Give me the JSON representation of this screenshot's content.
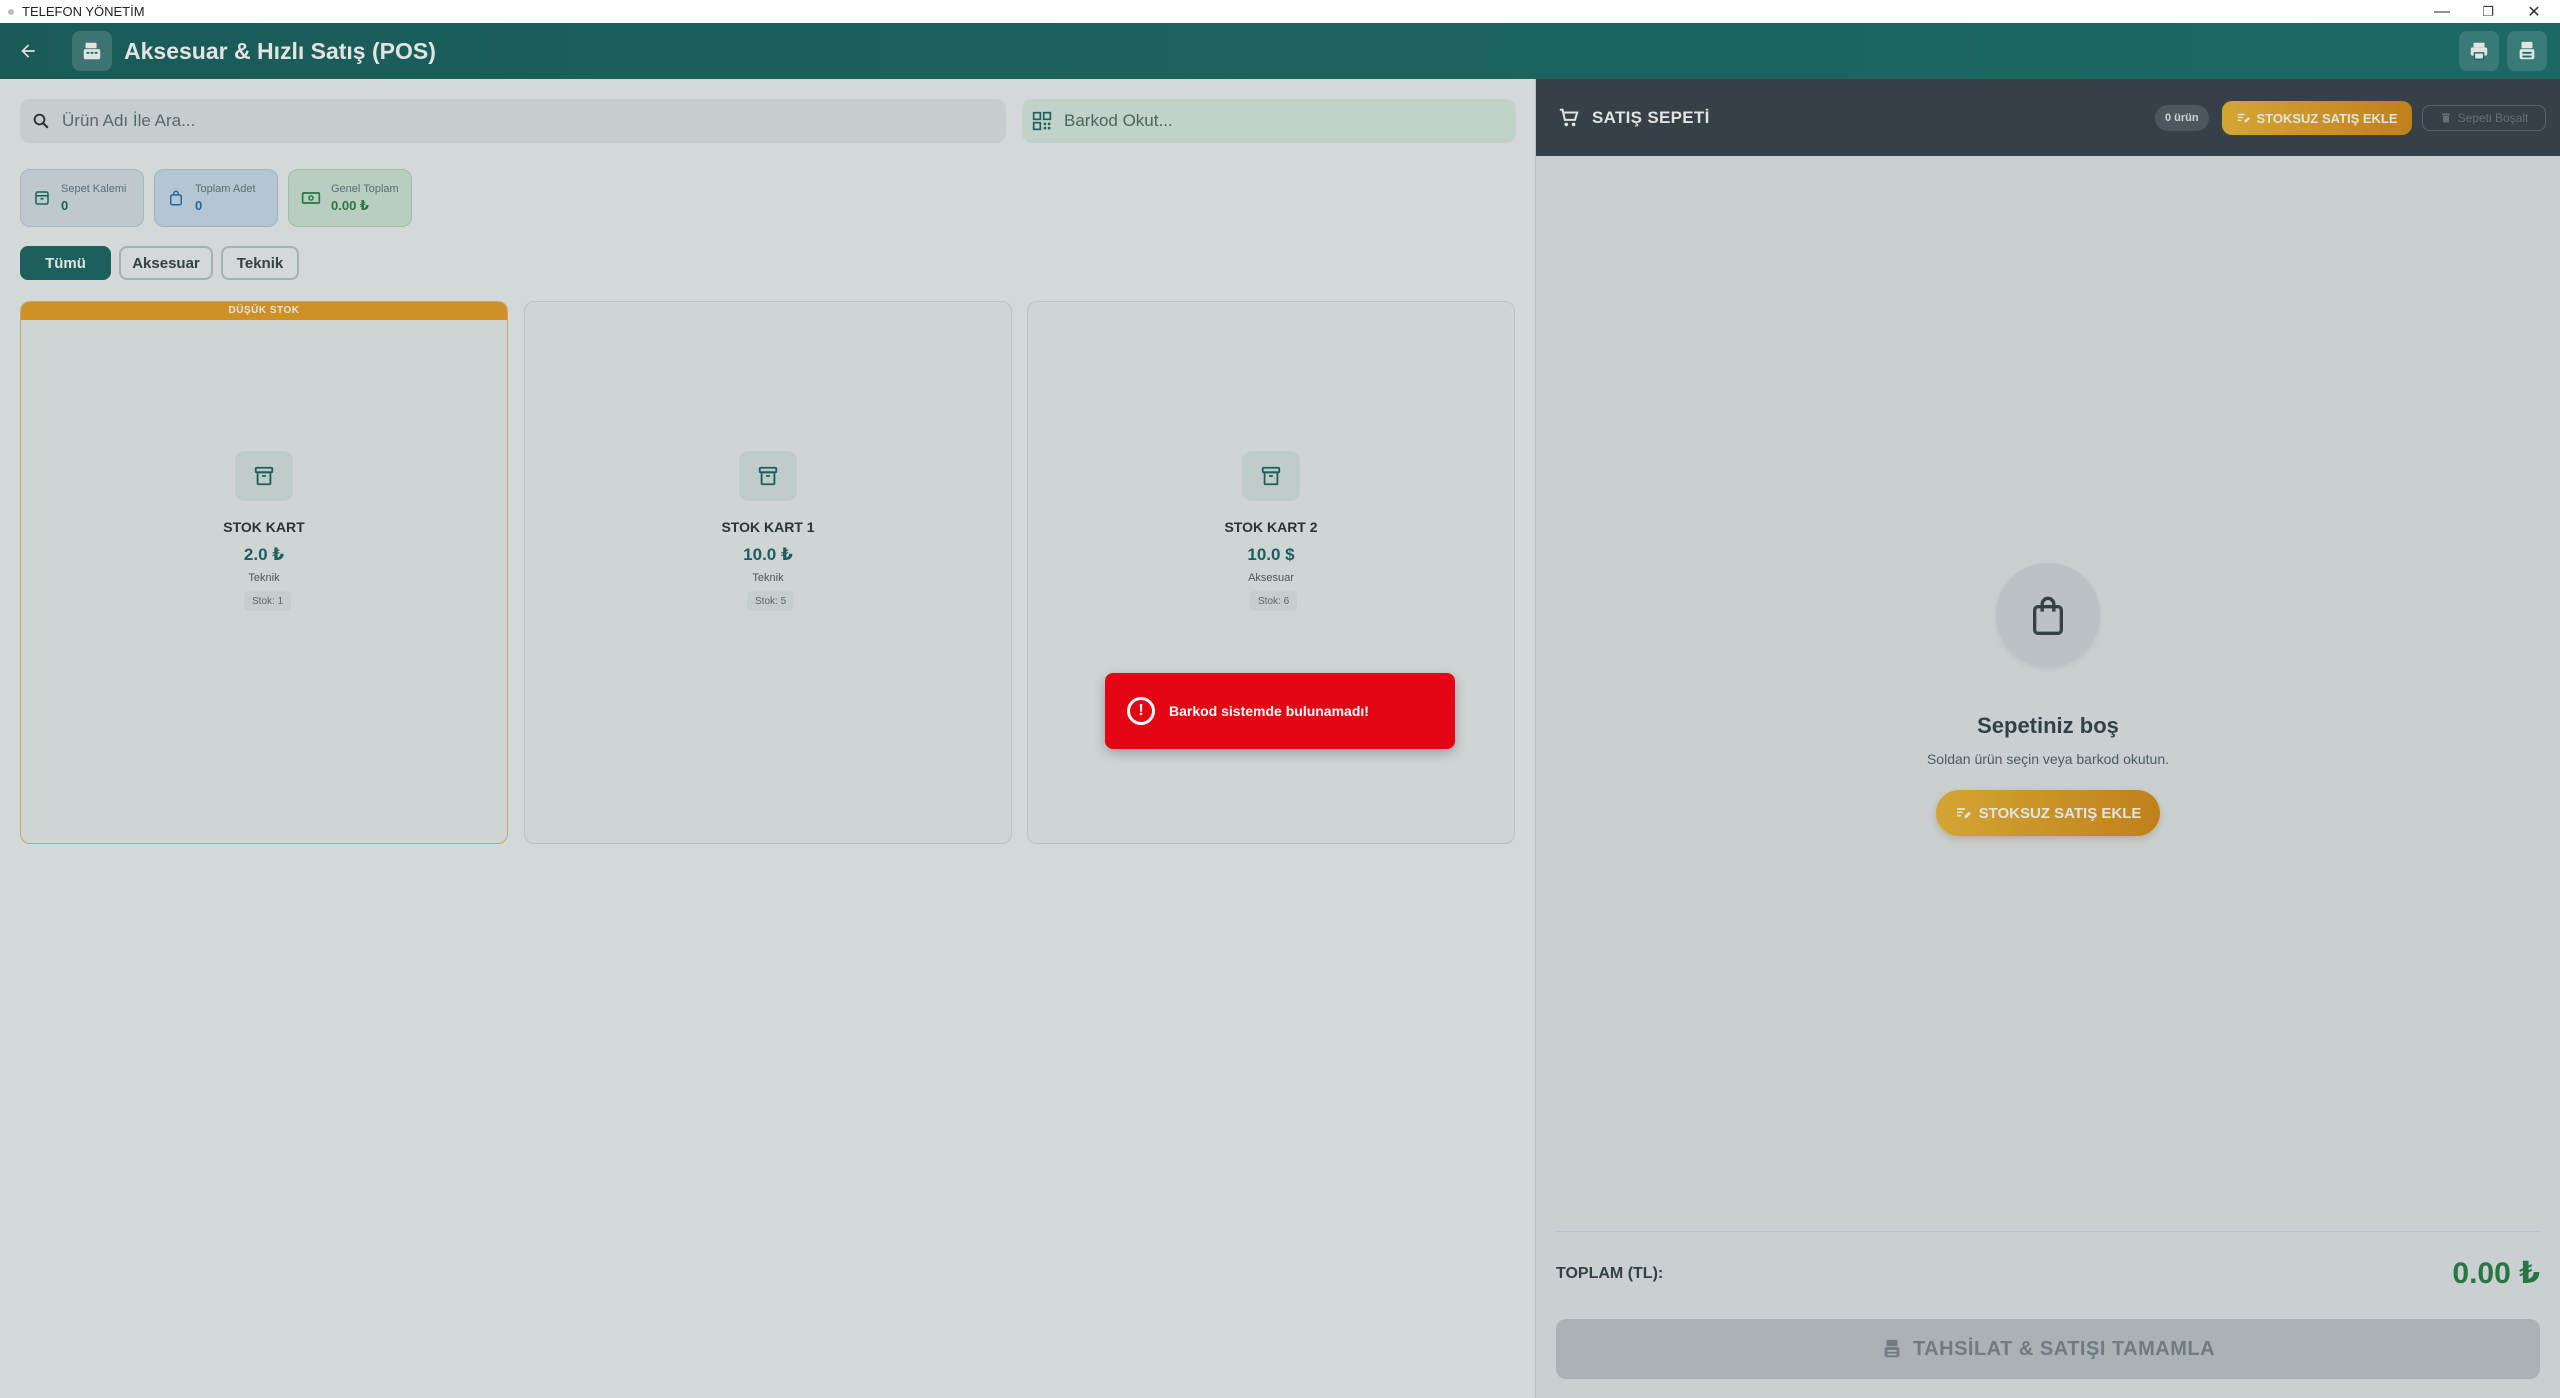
{
  "window": {
    "title": "TELEFON YÖNETİM",
    "minimize": "—",
    "restore": "❐",
    "close": "✕"
  },
  "appbar": {
    "title": "Aksesuar & Hızlı Satış (POS)"
  },
  "search": {
    "placeholder": "Ürün Adı İle Ara..."
  },
  "barcode": {
    "placeholder": "Barkod Okut..."
  },
  "stats": [
    {
      "label": "Sepet Kalemi",
      "value": "0"
    },
    {
      "label": "Toplam Adet",
      "value": "0"
    },
    {
      "label": "Genel Toplam",
      "value": "0.00 ₺"
    }
  ],
  "filters": [
    "Tümü",
    "Aksesuar",
    "Teknik"
  ],
  "products": [
    {
      "banner": "DÜŞÜK STOK",
      "name": "STOK KART",
      "price": "2.0 ₺",
      "category": "Teknik",
      "stock": "Stok: 1"
    },
    {
      "banner": "",
      "name": "STOK KART 1",
      "price": "10.0 ₺",
      "category": "Teknik",
      "stock": "Stok: 5"
    },
    {
      "banner": "",
      "name": "STOK KART 2",
      "price": "10.0 $",
      "category": "Aksesuar",
      "stock": "Stok: 6"
    }
  ],
  "toast": {
    "message": "Barkod sistemde bulunamadı!",
    "color": "#e30513"
  },
  "cart": {
    "title": "SATIŞ SEPETİ",
    "count_badge": "0 ürün",
    "add_unstocked": "STOKSUZ SATIŞ EKLE",
    "clear": "Sepeti Boşalt",
    "empty_title": "Sepetiniz boş",
    "empty_subtitle": "Soldan ürün seçin veya barkod okutun.",
    "total_label": "TOPLAM (TL):",
    "total_value": "0.00 ₺",
    "complete_label": "TAHSİLAT & SATIŞI TAMAMLA"
  },
  "colors": {
    "primary": "#0f5e58",
    "accent": "#e89c1a",
    "success": "#1f7a3e",
    "danger": "#e30513"
  }
}
